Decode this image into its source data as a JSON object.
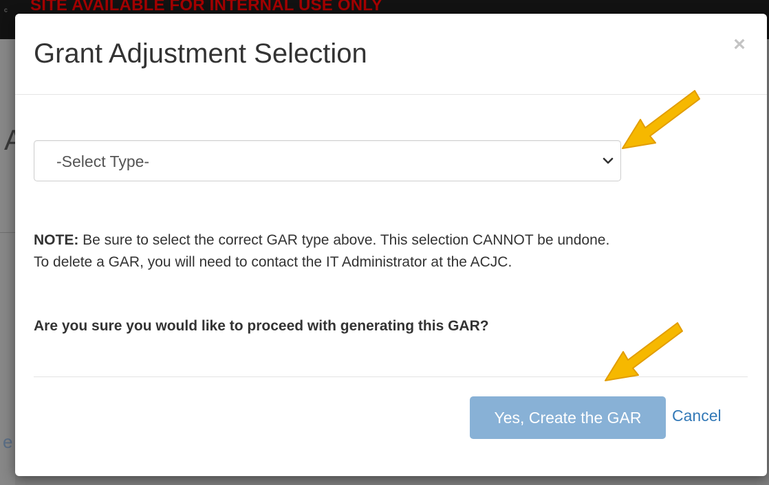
{
  "background": {
    "banner_text": "SITE AVAILABLE FOR INTERNAL USE ONLY"
  },
  "modal": {
    "title": "Grant Adjustment Selection",
    "close_label": "×",
    "select": {
      "selected_value": "-Select Type-"
    },
    "note_label": "NOTE:",
    "note_line1": " Be sure to select the correct GAR type above. This selection CANNOT be undone.",
    "note_line2": "To delete a GAR, you will need to contact the IT Administrator at the ACJC.",
    "question": "Are you sure you would like to proceed with generating this GAR?",
    "create_button_label": "Yes, Create the GAR",
    "cancel_label": "Cancel"
  },
  "colors": {
    "primary_button": "#88b1d6",
    "link": "#3379b7",
    "annotation_arrow": "#f6b800",
    "banner": "#a40000"
  },
  "icons": {
    "select_caret": "chevron-down-icon",
    "close": "close-icon",
    "annotation": "arrow-annotation-icon"
  }
}
